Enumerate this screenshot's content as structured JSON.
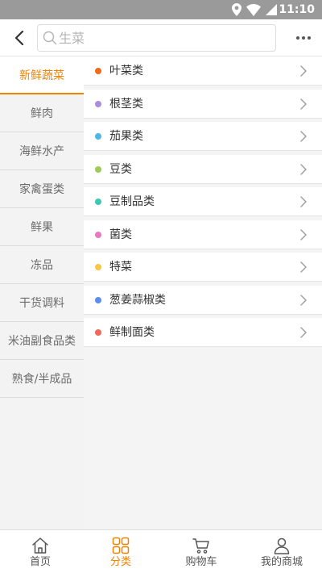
{
  "status_bar": {
    "time": "11:10"
  },
  "header": {
    "search_placeholder": "生菜"
  },
  "sidebar": {
    "items": [
      {
        "label": "新鲜蔬菜",
        "active": true
      },
      {
        "label": "鲜肉"
      },
      {
        "label": "海鲜水产"
      },
      {
        "label": "家禽蛋类"
      },
      {
        "label": "鲜果"
      },
      {
        "label": "冻品"
      },
      {
        "label": "干货调料"
      },
      {
        "label": "米油副食品类"
      },
      {
        "label": "熟食/半成品"
      }
    ]
  },
  "categories": [
    {
      "label": "叶菜类",
      "color": "#f06a1a"
    },
    {
      "label": "根茎类",
      "color": "#a98ddf"
    },
    {
      "label": "茄果类",
      "color": "#4db8e8"
    },
    {
      "label": "豆类",
      "color": "#9ccc54"
    },
    {
      "label": "豆制品类",
      "color": "#3cc8b4"
    },
    {
      "label": "菌类",
      "color": "#e878c0"
    },
    {
      "label": "特菜",
      "color": "#f8c844"
    },
    {
      "label": "葱姜蒜椒类",
      "color": "#5a8ee8"
    },
    {
      "label": "鲜制面类",
      "color": "#f0685a"
    }
  ],
  "tab_bar": {
    "items": [
      {
        "label": "首页",
        "icon": "home-icon"
      },
      {
        "label": "分类",
        "icon": "grid-icon",
        "active": true
      },
      {
        "label": "购物车",
        "icon": "cart-icon"
      },
      {
        "label": "我的商城",
        "icon": "user-icon"
      }
    ]
  },
  "colors": {
    "accent": "#f08200",
    "status_bar": "#9a9a9a"
  }
}
